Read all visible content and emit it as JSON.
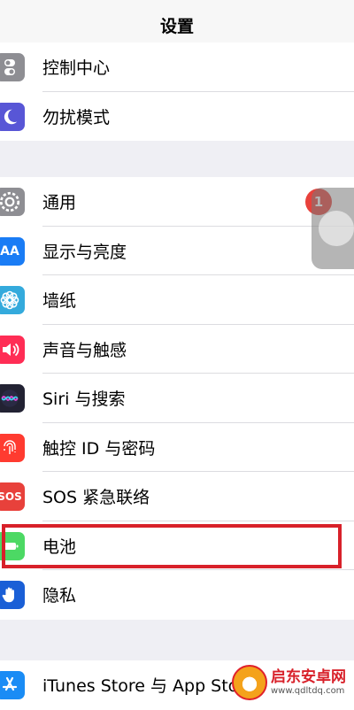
{
  "nav": {
    "title": "设置"
  },
  "groups": [
    {
      "items": [
        {
          "label": "控制中心",
          "icon": "control-center-icon",
          "color": "#8e8e93"
        },
        {
          "label": "勿扰模式",
          "icon": "moon-icon",
          "color": "#5856d6"
        }
      ]
    },
    {
      "items": [
        {
          "label": "通用",
          "icon": "gear-icon",
          "color": "#8e8e93",
          "badge": "1"
        },
        {
          "label": "显示与亮度",
          "icon": "display-aa-icon",
          "color": "#1a7cf5"
        },
        {
          "label": "墙纸",
          "icon": "wallpaper-flower-icon",
          "color": "#34aadc"
        },
        {
          "label": "声音与触感",
          "icon": "speaker-icon",
          "color": "#ff2d55"
        },
        {
          "label": "Siri 与搜索",
          "icon": "siri-icon",
          "color": "#222233"
        },
        {
          "label": "触控 ID 与密码",
          "icon": "fingerprint-icon",
          "color": "#ff3b30"
        },
        {
          "label": "SOS 紧急联络",
          "icon": "sos-icon",
          "color": "#e8413b",
          "icon_text": "SOS"
        },
        {
          "label": "电池",
          "icon": "battery-icon",
          "color": "#4cd964"
        },
        {
          "label": "隐私",
          "icon": "hand-icon",
          "color": "#1a5fd6"
        }
      ]
    },
    {
      "items": [
        {
          "label": "iTunes Store 与 App Sto",
          "icon": "app-store-icon",
          "color": "#1a8cf5"
        }
      ]
    }
  ],
  "watermark": {
    "name": "启东安卓网",
    "url": "www.qdltdq.com"
  },
  "colors": {
    "highlight": "#d8212a",
    "background": "#efeff4",
    "badge": "#e8413b"
  }
}
